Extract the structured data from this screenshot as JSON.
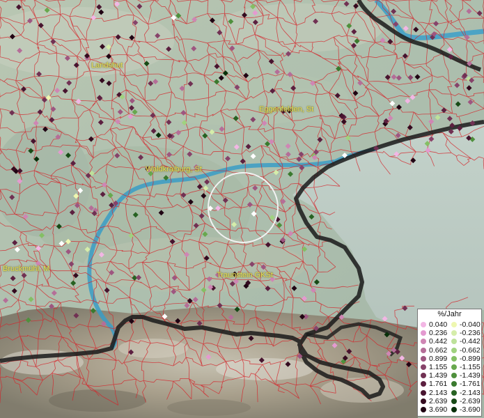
{
  "map": {
    "towns": [
      {
        "name": "Landshut",
        "pos": "upper-left"
      },
      {
        "name": "Eggenfelden, St",
        "pos": "upper-right"
      },
      {
        "name": "Waldkraiburg, St",
        "pos": "center"
      },
      {
        "name": "Bruckmühl, M",
        "pos": "left"
      },
      {
        "name": "Traunstein GKSt",
        "pos": "lower-center"
      }
    ]
  },
  "legend": {
    "title": "%/Jahr",
    "positive": [
      {
        "value": "0.040",
        "color": "#f2b6e4"
      },
      {
        "value": "0.236",
        "color": "#e49ad0"
      },
      {
        "value": "0.442",
        "color": "#cf86b4"
      },
      {
        "value": "0.662",
        "color": "#b56e98"
      },
      {
        "value": "0.899",
        "color": "#9e5680"
      },
      {
        "value": "1.155",
        "color": "#87436a"
      },
      {
        "value": "1.439",
        "color": "#713153"
      },
      {
        "value": "1.761",
        "color": "#5c2040"
      },
      {
        "value": "2.143",
        "color": "#48142f"
      },
      {
        "value": "2.639",
        "color": "#350b20"
      },
      {
        "value": "3.690",
        "color": "#200413"
      }
    ],
    "negative": [
      {
        "value": "-0.040",
        "color": "#eef7b0"
      },
      {
        "value": "-0.236",
        "color": "#d5edaa"
      },
      {
        "value": "-0.442",
        "color": "#bde19a"
      },
      {
        "value": "-0.662",
        "color": "#a0d27f"
      },
      {
        "value": "-0.899",
        "color": "#84bf64"
      },
      {
        "value": "-1.155",
        "color": "#68a84e"
      },
      {
        "value": "-1.439",
        "color": "#4f903d"
      },
      {
        "value": "-1.761",
        "color": "#3a7a2e"
      },
      {
        "value": "-2.143",
        "color": "#276222"
      },
      {
        "value": "-2.639",
        "color": "#174a16"
      },
      {
        "value": "-3.690",
        "color": "#08300a"
      }
    ]
  }
}
